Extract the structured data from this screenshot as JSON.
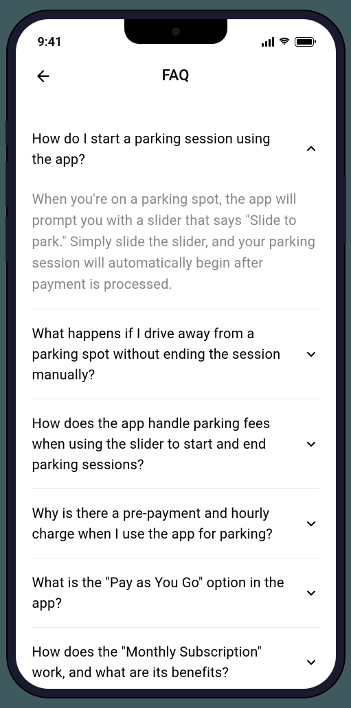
{
  "status_bar": {
    "time": "9:41"
  },
  "header": {
    "title": "FAQ"
  },
  "faq": {
    "items": [
      {
        "question": "How do I start a parking session using the app?",
        "answer": "When you're on a parking spot, the app will prompt you with a slider that says \"Slide to park.\" Simply slide the slider, and your parking session will automatically begin after payment is processed.",
        "expanded": true
      },
      {
        "question": "What happens if I drive away from a parking spot without ending the session manually?",
        "expanded": false
      },
      {
        "question": "How does the app handle parking fees when using the slider to start and end parking sessions?",
        "expanded": false
      },
      {
        "question": "Why is there a pre-payment and hourly charge when I use the app for parking?",
        "expanded": false
      },
      {
        "question": "What is the \"Pay as You Go\" option in the app?",
        "expanded": false
      },
      {
        "question": "How does the \"Monthly Subscription\" work, and what are its benefits?",
        "expanded": false
      }
    ]
  }
}
